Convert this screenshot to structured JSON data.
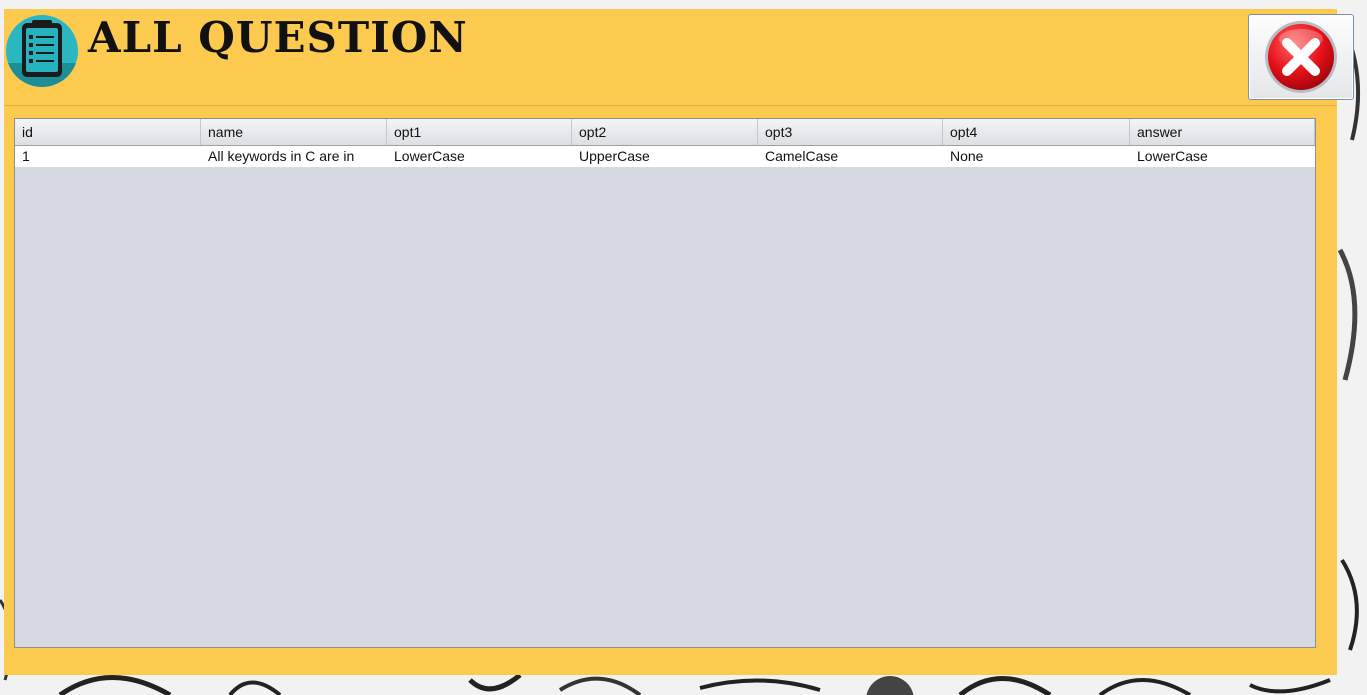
{
  "window": {
    "title": "ALL QUESTION",
    "icon": "document-list-icon",
    "close_icon": "close-x-icon",
    "accent_color": "#fbca4f"
  },
  "table": {
    "columns": [
      "id",
      "name",
      "opt1",
      "opt2",
      "opt3",
      "opt4",
      "answer"
    ],
    "rows": [
      [
        "1",
        "All keywords in C are in",
        "LowerCase",
        "UpperCase",
        "CamelCase",
        "None",
        "LowerCase"
      ]
    ]
  }
}
